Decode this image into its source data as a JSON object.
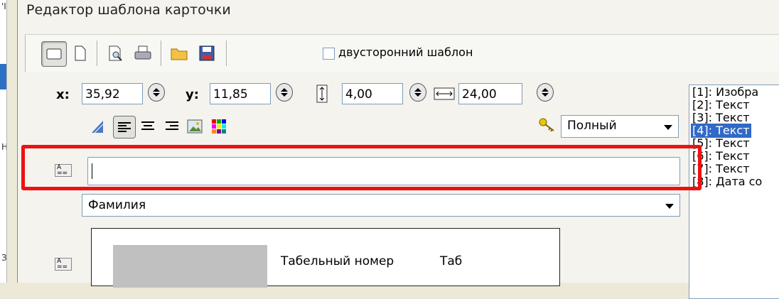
{
  "window": {
    "title": "Редактор шаблона карточки"
  },
  "background_marks": [
    "'I",
    "H",
    "Зе"
  ],
  "toolbar": {
    "buttons": [
      "card-front-icon",
      "card-back-icon",
      "print-preview-icon",
      "print-icon",
      "open-folder-icon",
      "save-icon"
    ],
    "double_sided_label": "двусторонний шаблон",
    "double_sided_checked": false
  },
  "position": {
    "x_label": "x:",
    "x_value": "35,92",
    "y_label": "y:",
    "y_value": "11,85",
    "height_value": "4,00",
    "width_value": "24,00"
  },
  "format": {
    "buttons": [
      "font-icon",
      "align-left-icon",
      "align-center-icon",
      "align-right-icon",
      "image-icon",
      "color-icon"
    ],
    "key_icon": "key-icon",
    "mode_value": "Полный"
  },
  "text_field": {
    "value": ""
  },
  "field_select": {
    "value": "Фамилия"
  },
  "preview": {
    "label1": "Табельный номер",
    "label2": "Таб"
  },
  "elements_list": {
    "items": [
      "[1]: Изобра",
      "[2]: Текст",
      "[3]: Текст",
      "[4]: Текст",
      "[5]: Текст",
      "[6]: Текст",
      "[7]: Текст",
      "[8]: Дата со"
    ],
    "selected_index": 3
  },
  "colors": {
    "highlight": "#ee1111",
    "selection": "#3169c6"
  }
}
